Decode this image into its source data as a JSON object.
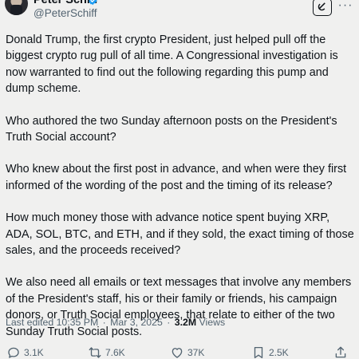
{
  "author": {
    "display_name": "Peter Schiff",
    "handle": "@PeterSchiff",
    "verified": true
  },
  "header_icons": {
    "grok": "grok-icon",
    "more": "more-icon"
  },
  "tweet": {
    "paragraphs": [
      "Donald Trump, the first crypto President, just helped pull off the biggest crypto rug pull of all time. A Congressional investigation is now warranted to find out the following regarding this pump and dump scheme.",
      "Who authored the two Sunday afternoon posts on the President's Truth Social account?",
      "Who knew about the first post in advance, and when were they first informed of the wording of the post and the timing of its release?",
      "How much money those with advance notice spent buying XRP, ADA, SOL, BTC, and ETH, and if they sold, the exact timing of those sales, and the proceeds received?",
      "We also need all emails or text messages that involve any members of the President's staff, his or their family or friends, his campaign donors, or Truth Social employees, that relate to either of the two Sunday Truth Social posts."
    ]
  },
  "meta": {
    "edited_label": "Last edited 10:35 PM",
    "separator": "·",
    "date": "Mar 3, 2025",
    "views_count": "3.2M",
    "views_label": "Views"
  },
  "actions": {
    "replies": "3.1K",
    "reposts": "7.6K",
    "likes": "37K",
    "bookmarks": "2.5K"
  },
  "colors": {
    "background": "#f0f0ef",
    "text": "#0f1419",
    "secondary": "#536471",
    "verified": "#1d9bf0"
  }
}
